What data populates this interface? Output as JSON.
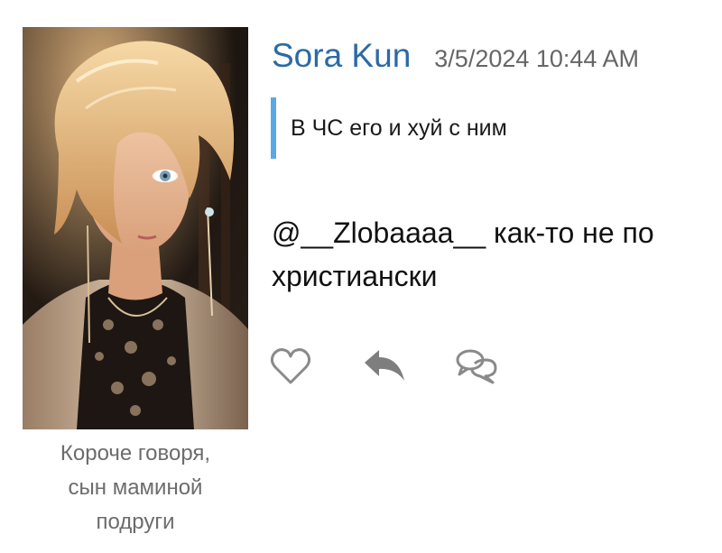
{
  "post": {
    "username": "Sora Kun",
    "timestamp": "3/5/2024 10:44 AM",
    "quote": "В ЧС его и хуй с ним",
    "message": "@__Zlobaaaa__ как-то не по христиански",
    "avatar_caption": [
      "Короче говоря,",
      "сын маминой",
      "подруги"
    ]
  },
  "actions": {
    "icons": [
      "heart-icon",
      "reply-arrow-icon",
      "comments-icon"
    ],
    "icon_color": "#8a8a8a"
  },
  "colors": {
    "username": "#2b6aa4",
    "quote_bar": "#5aa9e6",
    "caption": "#6c6c6c"
  }
}
